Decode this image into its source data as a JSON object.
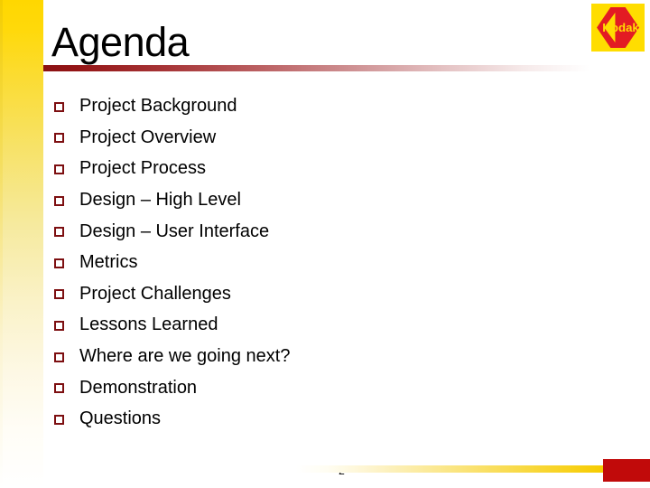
{
  "slide": {
    "title": "Agenda",
    "page_number": "2",
    "bullets": [
      {
        "text": "Project Background"
      },
      {
        "text": "Project Overview"
      },
      {
        "text": "Project Process"
      },
      {
        "text": "Design – High Level"
      },
      {
        "text": "Design – User Interface"
      },
      {
        "text": "Metrics"
      },
      {
        "text": "Project Challenges"
      },
      {
        "text": "Lessons Learned"
      },
      {
        "text": "Where are we going next?"
      },
      {
        "text": "Demonstration"
      },
      {
        "text": "Questions"
      }
    ],
    "bullet_marker_icon": "hollow-square-bullet-icon",
    "logo": {
      "name": "kodak-logo",
      "wordmark": "Kodak"
    },
    "colors": {
      "accent_yellow": "#ffd700",
      "accent_red": "#c10a0a",
      "bullet_maroon": "#7d0f11",
      "rule_dark_red": "#8a1113",
      "logo_yellow": "#ffdd00",
      "logo_red": "#e31b23",
      "text_black": "#000000",
      "background": "#ffffff"
    }
  }
}
